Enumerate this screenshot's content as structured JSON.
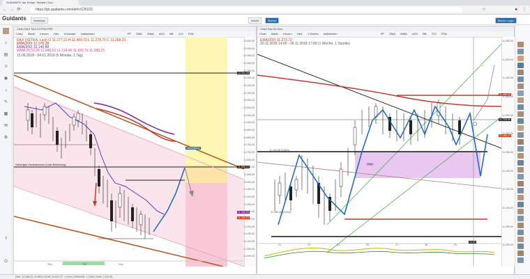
{
  "browser": {
    "tab_title": "GUIDANTS: der Kompl. Stream | Gui...",
    "url": "https://go.guidants.com/de#c/125221"
  },
  "app": {
    "logo": "Guidants",
    "tabs": [
      "Desktops"
    ],
    "right_buttons": {
      "search": "Suche",
      "market": "Market",
      "broker": "Broker Login"
    }
  },
  "left_chart": {
    "title": "Chart DAX TAG EXTRA PRE",
    "toolbar": [
      "Chart",
      "Markt",
      "Kerzen",
      "Hist.",
      "6 Monate",
      "Indikatoren"
    ],
    "toolbar_right": [
      "PP",
      "SMA",
      "WMA",
      "ADX",
      "BB",
      "CCI",
      "PSA"
    ],
    "legend": [
      {
        "text": "DAX (XETRA, Last) O 11.277,21 H 11.403,72 L 11.278,70 C 11.288,23",
        "color": "#d4380d"
      },
      {
        "text": "EMA(200) 12.076,38",
        "color": "#8b2c2c"
      },
      {
        "text": "EMA(200) 12.146,88",
        "color": "#7a1fa0"
      },
      {
        "text": "WMA 26,52,26 11.046,63  11.214,40  11.150,79  11.288,23",
        "color": "#d43f8d"
      }
    ],
    "date_range": "15.06.2018 - 04.01.2019 (5 Monate, 1 Tag)",
    "annotations": [
      "Widerstand",
      "Vorheriges Handelsniveau (Unter Bedeutung)"
    ],
    "price_axis": [
      "12.500,00",
      "12.400,00",
      "12.350,00",
      "12.300,00",
      "12.250,00",
      "12.200,00",
      "12.150,00",
      "12.100,00",
      "12.050,00",
      "12.000,00",
      "11.950,00",
      "11.900,00",
      "11.850,00",
      "11.800,00",
      "11.750,00",
      "11.700,00",
      "11.650,00",
      "11.600,00",
      "11.550,00",
      "11.500,00",
      "11.450,00",
      "11.400,00",
      "11.350,00",
      "11.300,00",
      "11.250,00",
      "11.200,00",
      "11.150,00",
      "11.100,00",
      "11.050,00",
      "11.000,00"
    ],
    "price_tags": [
      {
        "text": "12.003,26",
        "color": "#222"
      },
      {
        "text": "11.808,10",
        "color": "#222"
      },
      {
        "text": "11.346,25",
        "color": "#7a1fa0"
      },
      {
        "text": "11.288,23",
        "color": "#d4380d"
      }
    ],
    "x_labels": [
      "Sep",
      "Okt",
      "Nov"
    ]
  },
  "right_chart": {
    "title": "Chart Dax 60 Neu",
    "toolbar": [
      "Chart",
      "Markt",
      "Kerzen",
      "Hist.",
      "1 Woche",
      "Indikatoren"
    ],
    "toolbar_right": [
      "PP",
      "SMA",
      "WMA",
      "ADX",
      "BB",
      "CCI",
      "PSA"
    ],
    "legend": [
      {
        "text": "EMA(200) 11.273,72",
        "color": "#c0392b"
      }
    ],
    "date_range": "20.11.2018 14:00 - 26.11.2018 17:00 (1 Woche, 1 Stunde)",
    "annotations": [
      "11.239,45 (0,85%)",
      "Gap",
      "11.056,30 (0,64%)"
    ],
    "price_tags": [
      {
        "text": "11.450,00",
        "color": "#c0392b"
      },
      {
        "text": "11.238,08",
        "color": "#222"
      },
      {
        "text": "11.288,23",
        "color": "#d4380d"
      },
      {
        "text": "12:00",
        "color": "#222"
      }
    ],
    "x_labels": [
      "21",
      "22",
      "23",
      "26",
      "27",
      "28",
      "29"
    ],
    "price_axis": [
      "11.550,00",
      "11.500,00",
      "11.450,00",
      "11.400,00",
      "11.350,00",
      "11.300,00",
      "11.250,00",
      "11.200,00",
      "11.150,00",
      "11.100,00",
      "11.050,00",
      "11.000,00"
    ]
  },
  "bottom": {
    "status": "DAX: 11.288,23  +0,28%   |   DOW: 24.527,27  -1,24%   |   EUR/USD: 1,1362   |   Gold: 1.222,06"
  }
}
